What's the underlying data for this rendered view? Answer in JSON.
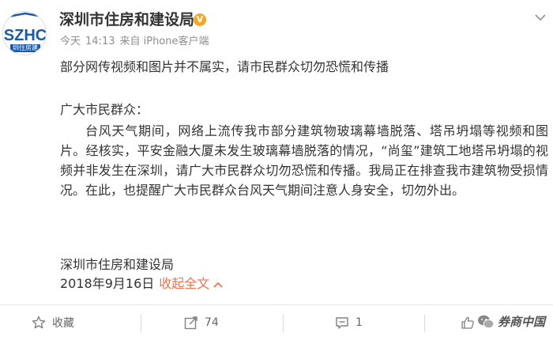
{
  "post": {
    "author": "深圳市住房和建设局",
    "avatar": {
      "logo_text": "SZHC",
      "caption": "圳住房建"
    },
    "meta": {
      "day": "今天",
      "time": "14:13",
      "source": "来自 iPhone客户端"
    },
    "headline": "部分网传视频和图片并不属实，请市民群众切勿恐慌和传播",
    "greeting": "广大市民群众：",
    "body": "台风天气期间，网络上流传我市部分建筑物玻璃幕墙脱落、塔吊坍塌等视频和图片。经核实，平安金融大厦未发生玻璃幕墙脱落的情况，“尚玺”建筑工地塔吊坍塌的视频并非发生在深圳，请广大市民群众切勿恐慌和传播。我局正在排查我市建筑物受损情况。在此，也提醒广大市民群众台风天气期间注意人身安全，切勿外出。",
    "signature": "深圳市住房和建设局",
    "date": "2018年9月16日",
    "collapse_label": "收起全文",
    "collapse_icon": "chevron-up-icon"
  },
  "actions": {
    "favorite": {
      "label": "收藏",
      "icon": "star-icon"
    },
    "repost": {
      "count": "74",
      "icon": "share-icon"
    },
    "comment": {
      "count": "1",
      "icon": "comment-icon"
    },
    "like": {
      "icon": "thumb-up-icon"
    }
  },
  "watermark": {
    "text": "券商中国"
  },
  "colors": {
    "accent": "#eb7350",
    "verified": "#f5a623",
    "logo_blue": "#1a5aa8"
  }
}
